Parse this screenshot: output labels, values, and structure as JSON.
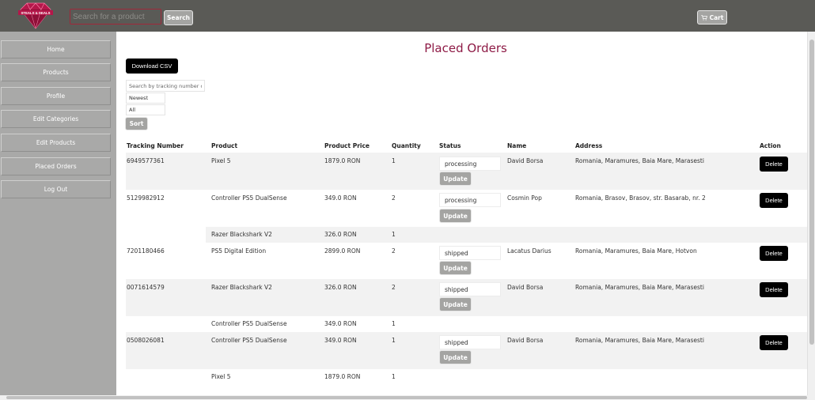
{
  "header": {
    "logo_text": "STEALS & DEALS",
    "search_placeholder": "Search for a product",
    "search_button": "Search",
    "cart_label": "Cart"
  },
  "sidebar": {
    "items": [
      {
        "label": "Home"
      },
      {
        "label": "Products"
      },
      {
        "label": "Profile"
      },
      {
        "label": "Edit Categories"
      },
      {
        "label": "Edit Products"
      },
      {
        "label": "Placed Orders"
      },
      {
        "label": "Log Out"
      }
    ]
  },
  "main": {
    "title": "Placed Orders",
    "download_csv": "Download CSV",
    "tracking_search_placeholder": "Search by tracking number or",
    "order_select": "Newest",
    "status_select": "All",
    "sort_button": "Sort",
    "columns": [
      "Tracking Number",
      "Product",
      "Product Price",
      "Quantity",
      "Status",
      "Name",
      "Address",
      "Action"
    ],
    "orders": [
      {
        "tracking": "6949577361",
        "status": "processing",
        "update": "Update",
        "name": "David Borsa",
        "address": "Romania, Maramures, Baia Mare, Marasesti",
        "delete": "Delete",
        "items": [
          {
            "product": "Pixel 5",
            "price": "1879.0 RON",
            "qty": "1"
          }
        ]
      },
      {
        "tracking": "5129982912",
        "status": "processing",
        "update": "Update",
        "name": "Cosmin Pop",
        "address": "Romania, Brasov, Brasov, str. Basarab, nr. 2",
        "delete": "Delete",
        "items": [
          {
            "product": "Controller PS5 DualSense",
            "price": "349.0 RON",
            "qty": "2"
          },
          {
            "product": "Razer Blackshark V2",
            "price": "326.0 RON",
            "qty": "1"
          }
        ]
      },
      {
        "tracking": "7201180466",
        "status": "shipped",
        "update": "Update",
        "name": "Lacatus Darius",
        "address": "Romania, Maramures, Baia Mare, Hotvon",
        "delete": "Delete",
        "items": [
          {
            "product": "PS5 Digital Edition",
            "price": "2899.0 RON",
            "qty": "2"
          }
        ]
      },
      {
        "tracking": "0071614579",
        "status": "shipped",
        "update": "Update",
        "name": "David Borsa",
        "address": "Romania, Maramures, Baia Mare, Marasesti",
        "delete": "Delete",
        "items": [
          {
            "product": "Razer Blackshark V2",
            "price": "326.0 RON",
            "qty": "2"
          },
          {
            "product": "Controller PS5 DualSense",
            "price": "349.0 RON",
            "qty": "1"
          }
        ]
      },
      {
        "tracking": "0508026081",
        "status": "shipped",
        "update": "Update",
        "name": "David Borsa",
        "address": "Romania, Maramures, Baia Mare, Marasesti",
        "delete": "Delete",
        "items": [
          {
            "product": "Controller PS5 DualSense",
            "price": "349.0 RON",
            "qty": "1"
          },
          {
            "product": "Pixel 5",
            "price": "1879.0 RON",
            "qty": "1"
          }
        ]
      }
    ]
  },
  "colors": {
    "header_bg": "#5a5a56",
    "sidebar_bg": "#a9a9a8",
    "title": "#8e1b46",
    "row_stripe": "#f2f2f2"
  },
  "icons": {
    "cart": "cart-icon",
    "logo": "diamond-logo"
  }
}
